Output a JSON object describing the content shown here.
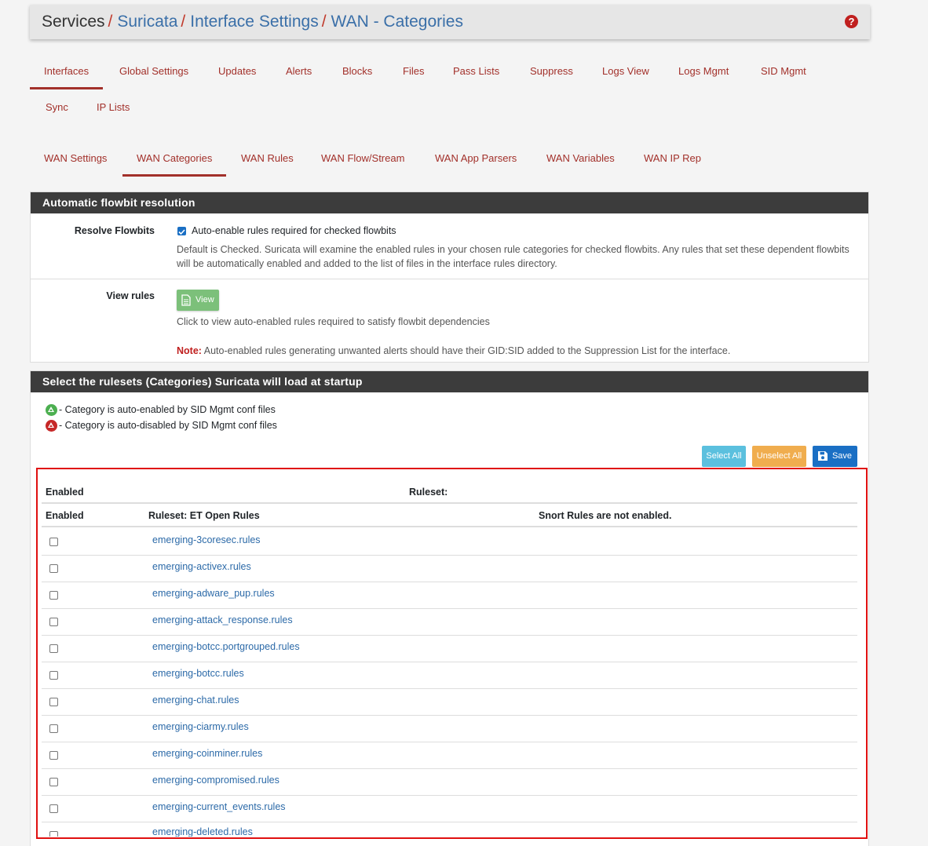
{
  "breadcrumb": {
    "root": "Services",
    "items": [
      "Suricata",
      "Interface Settings",
      "WAN - Categories"
    ],
    "separator": "/"
  },
  "help_icon": "question-circle-icon",
  "main_tabs": [
    {
      "label": "Interfaces",
      "active": true
    },
    {
      "label": "Global Settings"
    },
    {
      "label": "Updates"
    },
    {
      "label": "Alerts"
    },
    {
      "label": "Blocks"
    },
    {
      "label": "Files"
    },
    {
      "label": "Pass Lists"
    },
    {
      "label": "Suppress"
    },
    {
      "label": "Logs View"
    },
    {
      "label": "Logs Mgmt"
    },
    {
      "label": "SID Mgmt"
    },
    {
      "label": "Sync"
    },
    {
      "label": "IP Lists"
    }
  ],
  "sub_tabs": [
    {
      "label": "WAN Settings"
    },
    {
      "label": "WAN Categories",
      "active": true
    },
    {
      "label": "WAN Rules"
    },
    {
      "label": "WAN Flow/Stream"
    },
    {
      "label": "WAN App Parsers"
    },
    {
      "label": "WAN Variables"
    },
    {
      "label": "WAN IP Rep"
    }
  ],
  "flowbit_panel": {
    "title": "Automatic flowbit resolution",
    "resolve_label": "Resolve Flowbits",
    "resolve_checkbox_label": "Auto-enable rules required for checked flowbits",
    "resolve_checked": true,
    "resolve_help": "Default is Checked. Suricata will examine the enabled rules in your chosen rule categories for checked flowbits. Any rules that set these dependent flowbits will be automatically enabled and added to the list of files in the interface rules directory.",
    "view_label": "View rules",
    "view_button": "View",
    "view_help": "Click to view auto-enabled rules required to satisfy flowbit dependencies",
    "note_label": "Note:",
    "note_text": " Auto-enabled rules generating unwanted alerts should have their GID:SID added to the Suppression List for the interface."
  },
  "rulesets_panel": {
    "title": "Select the rulesets (Categories) Suricata will load at startup",
    "legend_enabled": "- Category is auto-enabled by SID Mgmt conf files",
    "legend_disabled": "- Category is auto-disabled by SID Mgmt conf files",
    "select_all": "Select All",
    "unselect_all": "Unselect All",
    "save": "Save",
    "colors": {
      "select_all": "#5bc0de",
      "unselect_all": "#f0ad4e",
      "save": "#1a6fc4",
      "enabled_legend": "#4caf50",
      "disabled_legend": "#c62828"
    }
  },
  "table": {
    "header1": {
      "enabled": "Enabled",
      "ruleset": "Ruleset:"
    },
    "header2": {
      "enabled": "Enabled",
      "ruleset": "Ruleset: ET Open Rules",
      "snort": "Snort Rules are not enabled."
    },
    "rules": [
      "emerging-3coresec.rules",
      "emerging-activex.rules",
      "emerging-adware_pup.rules",
      "emerging-attack_response.rules",
      "emerging-botcc.portgrouped.rules",
      "emerging-botcc.rules",
      "emerging-chat.rules",
      "emerging-ciarmy.rules",
      "emerging-coinminer.rules",
      "emerging-compromised.rules",
      "emerging-current_events.rules",
      "emerging-deleted.rules"
    ]
  }
}
